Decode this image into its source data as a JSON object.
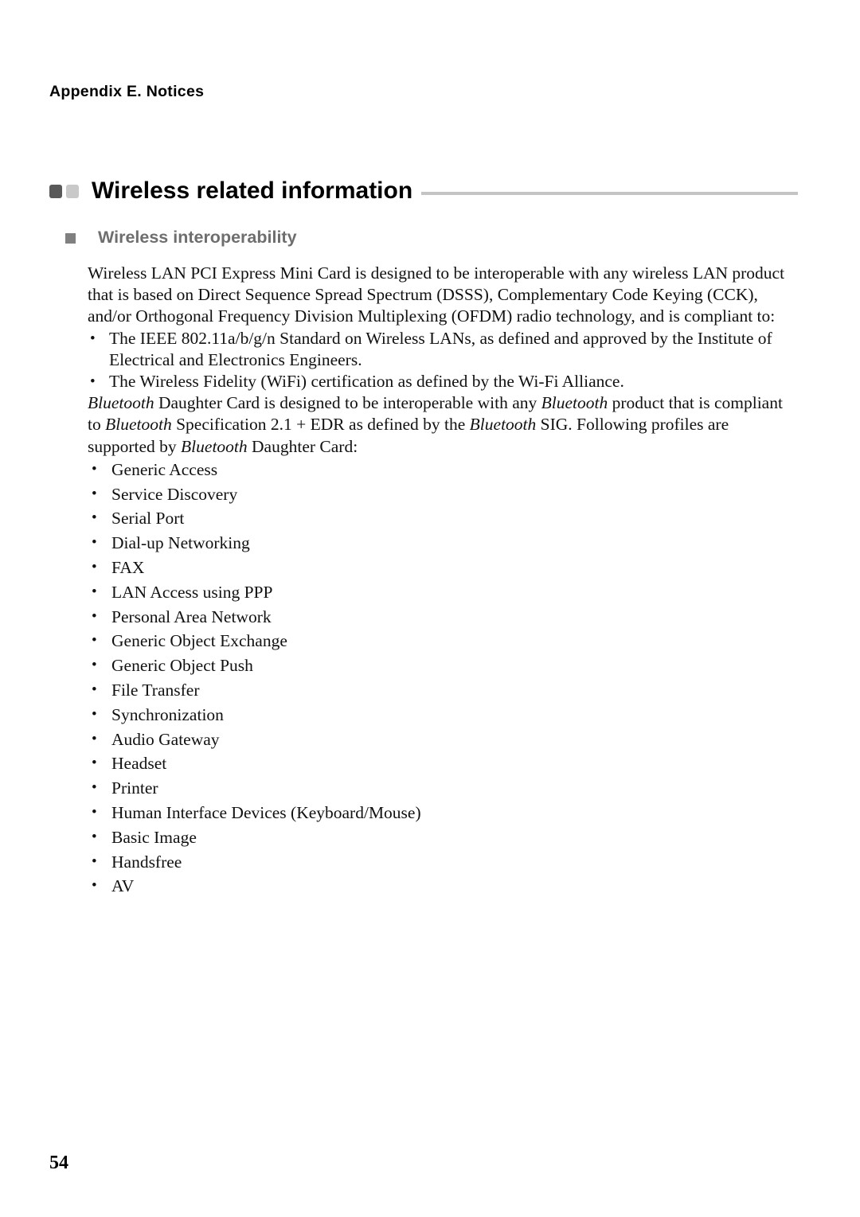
{
  "running_head": "Appendix E. Notices",
  "title": {
    "text": "Wireless related information",
    "square_dark_color": "#595959",
    "square_light_color": "#c9c9c9",
    "rule_color": "#c4c4c4"
  },
  "subheading": {
    "text": "Wireless interoperability",
    "color": "#6e6e6e",
    "bullet_color": "#808080"
  },
  "paragraphs": {
    "intro": "Wireless LAN PCI Express Mini Card is designed to be interoperable with any wireless LAN product that is based on Direct Sequence Spread Spectrum (DSSS), Complementary Code Keying (CCK), and/or Orthogonal Frequency Division Multiplexing (OFDM) radio technology, and is compliant to:",
    "bluetooth_1": "Daughter Card is designed to be interoperable with any",
    "bluetooth_2": "product that is compliant to",
    "bluetooth_3": "Specification 2.1 + EDR as defined by the",
    "bluetooth_4": "SIG. Following profiles are supported by",
    "bluetooth_5": "Daughter Card:",
    "bluetooth_word": "Bluetooth"
  },
  "standards_bullets": [
    "The IEEE 802.11a/b/g/n Standard on Wireless LANs, as defined and approved by the Institute of Electrical and Electronics Engineers.",
    "The Wireless Fidelity (WiFi) certification as defined by the Wi-Fi Alliance."
  ],
  "profiles": [
    "Generic Access",
    "Service Discovery",
    "Serial Port",
    "Dial-up Networking",
    "FAX",
    "LAN Access using PPP",
    "Personal Area Network",
    "Generic Object Exchange",
    "Generic Object Push",
    "File Transfer",
    "Synchronization",
    "Audio Gateway",
    "Headset",
    "Printer",
    "Human Interface Devices (Keyboard/Mouse)",
    "Basic Image",
    "Handsfree",
    "AV"
  ],
  "page_number": "54"
}
